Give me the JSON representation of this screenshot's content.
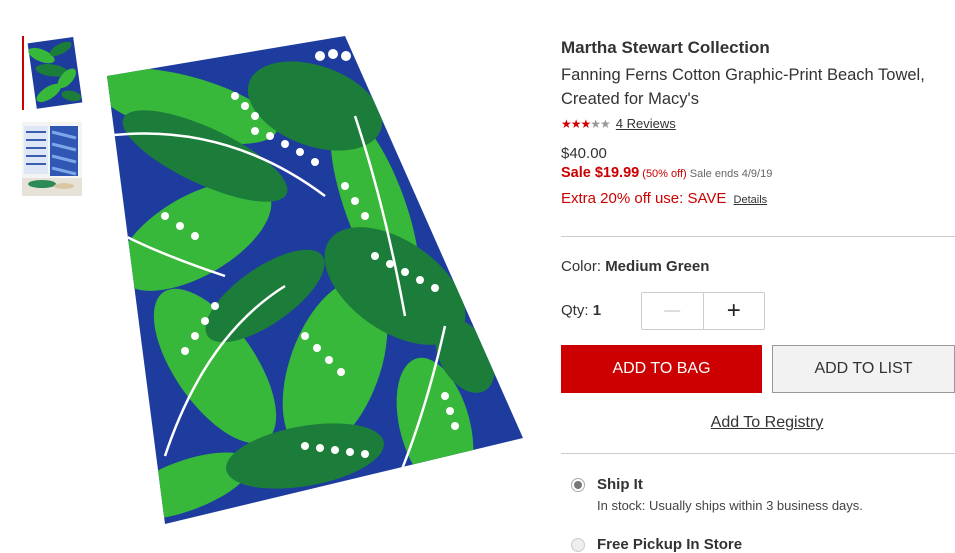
{
  "product": {
    "brand": "Martha Stewart Collection",
    "title_line1": "Fanning Ferns Cotton Graphic-Print Beach Towel,",
    "title_line2": "Created for Macy's",
    "rating": {
      "stars": 3,
      "max": 5,
      "reviews_label": "4 Reviews"
    },
    "original_price": "$40.00",
    "sale_label": "Sale $19.99",
    "sale_discount": "(50% off)",
    "sale_ends": "Sale ends 4/9/19",
    "extra_offer": "Extra 20% off use: SAVE",
    "details_label": "Details"
  },
  "selection": {
    "color_label": "Color:",
    "color_value": "Medium Green",
    "qty_label": "Qty:",
    "qty_value": "1",
    "minus_symbol": "—",
    "plus_symbol": "+"
  },
  "actions": {
    "add_to_bag": "ADD TO BAG",
    "add_to_list": "ADD TO LIST",
    "add_to_registry": "Add To Registry"
  },
  "shipping": [
    {
      "title": "Ship It",
      "subtitle": "In stock: Usually ships within 3 business days.",
      "selected": true
    },
    {
      "title": "Free Pickup In Store",
      "subtitle": "",
      "selected": false
    }
  ],
  "colors": {
    "brand_red": "#cc0000",
    "towel_blue": "#1d3c9e",
    "leaf_bright": "#38b83a",
    "leaf_dark": "#1c7d3a"
  },
  "images": {
    "main": "fern-beach-towel",
    "thumbnails": [
      "fern-beach-towel",
      "blue-towel-lifestyle"
    ]
  }
}
